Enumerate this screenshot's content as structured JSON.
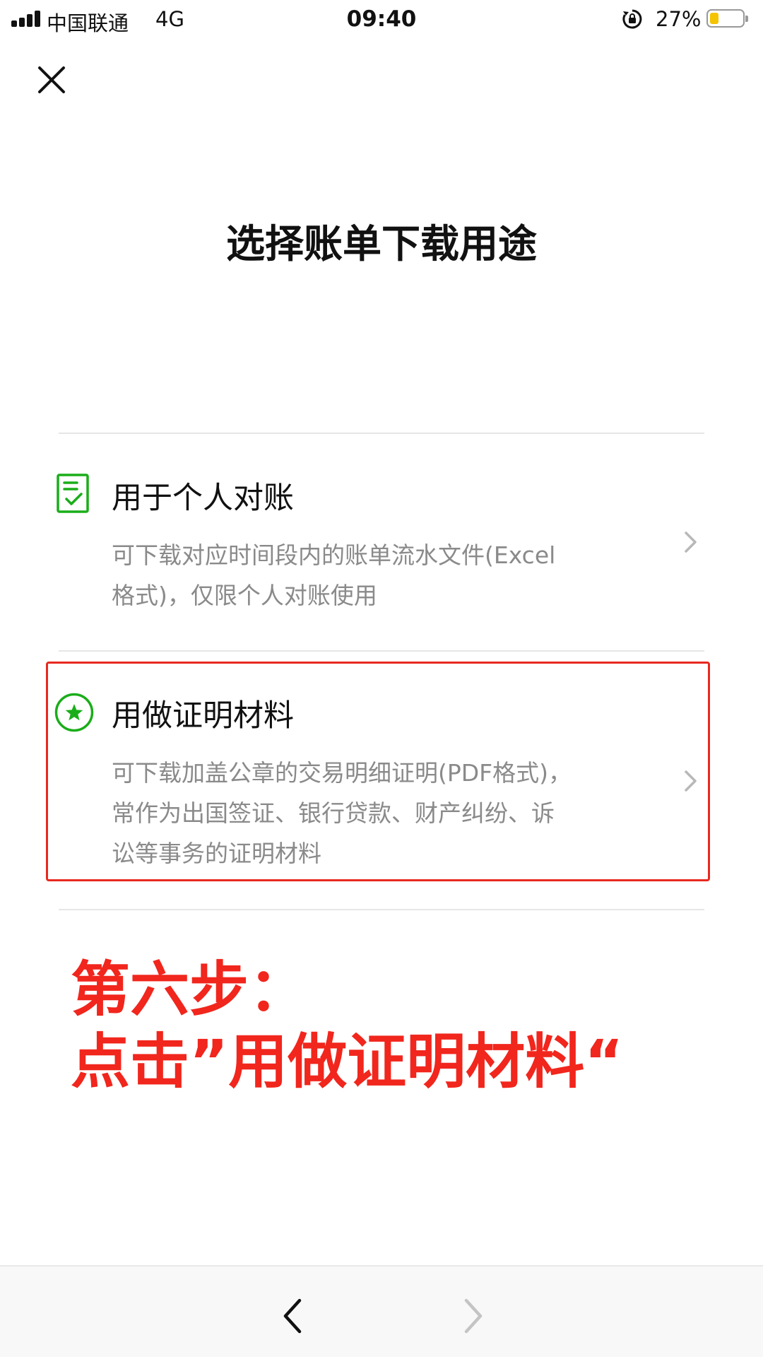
{
  "status_bar": {
    "carrier": "中国联通",
    "network": "4G",
    "time": "09:40",
    "battery_percent": "27%",
    "battery_level": 0.27,
    "battery_color": "#f5c400"
  },
  "header": {
    "close_icon": "close-icon",
    "title": "选择账单下载用途"
  },
  "options": [
    {
      "icon": "doc-check-icon",
      "title": "用于个人对账",
      "description_lines": [
        "可下载对应时间段内的账单流水文件(Excel",
        "格式)，仅限个人对账使用"
      ]
    },
    {
      "icon": "star-badge-icon",
      "title": "用做证明材料",
      "description_lines": [
        "可下载加盖公章的交易明细证明(PDF格式)，",
        "常作为出国签证、银行贷款、财产纠纷、诉",
        "讼等事务的证明材料"
      ]
    }
  ],
  "annotation": {
    "line1": "第六步：",
    "line2": "点击”用做证明材料“",
    "color": "#f1261d"
  },
  "colors": {
    "accent_green": "#1aad19",
    "highlight_red": "#e8291f"
  },
  "bottom_bar": {
    "back_icon": "chevron-left-icon",
    "forward_icon": "chevron-right-icon"
  }
}
